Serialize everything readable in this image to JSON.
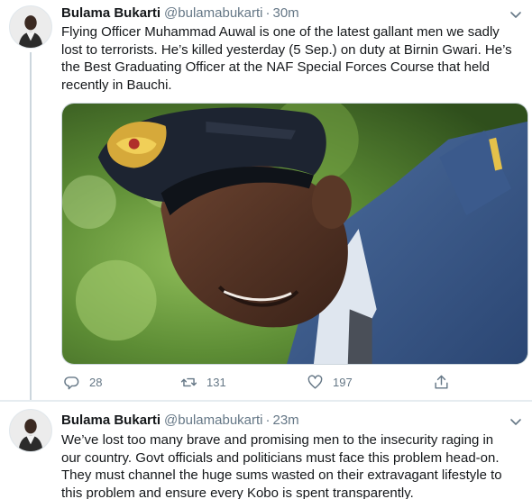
{
  "tweets": [
    {
      "author_name": "Bulama Bukarti",
      "handle": "@bulamabukarti",
      "separator": "·",
      "time": "30m",
      "text": "Flying Officer Muhammad Auwal is one of the latest gallant men we sadly lost to terrorists. He’s killed yesterday (5 Sep.) on duty at Birnin Gwari. He’s the Best Graduating Officer at the NAF Special Forces Course that held recently in Bauchi.",
      "actions": {
        "reply_count": "28",
        "retweet_count": "131",
        "like_count": "197"
      }
    },
    {
      "author_name": "Bulama Bukarti",
      "handle": "@bulamabukarti",
      "separator": "·",
      "time": "23m",
      "text": "We’ve lost too many brave and promising men to the insecurity raging in our country. Govt officials and politicians must face this problem head-on. They must channel the huge sums wasted on their extravagant lifestyle to this problem and ensure every Kobo is spent transparently."
    }
  ],
  "icons": {
    "reply": "reply-icon",
    "retweet": "retweet-icon",
    "like": "heart-icon",
    "share": "share-icon",
    "menu": "chevron-down-icon"
  },
  "colors": {
    "text_primary": "#14171a",
    "text_secondary": "#657786",
    "divider": "#e6ecf0"
  }
}
